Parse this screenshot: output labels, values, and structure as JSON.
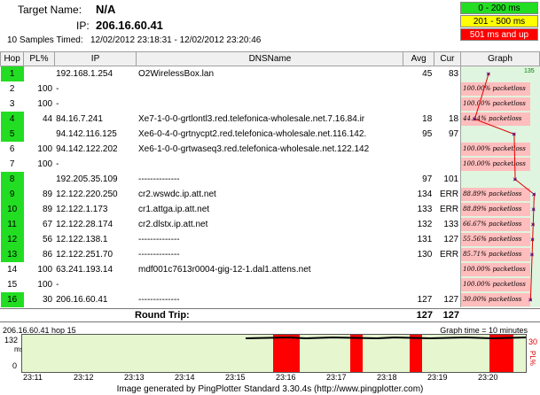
{
  "header": {
    "target_label": "Target Name:",
    "target_value": "N/A",
    "ip_label": "IP:",
    "ip_value": "206.16.60.41",
    "samples": "10 Samples Timed:",
    "range": "12/02/2012 23:18:31 - 12/02/2012 23:20:46",
    "legend": [
      {
        "label": "0 - 200 ms",
        "color": "#22dd22"
      },
      {
        "label": "201 - 500 ms",
        "color": "#ffff00"
      },
      {
        "label": "501 ms and up",
        "color": "#ff0000"
      }
    ]
  },
  "columns": [
    "Hop",
    "PL%",
    "IP",
    "DNSName",
    "Avg",
    "Cur",
    "Graph"
  ],
  "rows": [
    {
      "hop": "1",
      "pl": "",
      "ip": "192.168.1.254",
      "dns": "O2WirelessBox.lan",
      "avg": "45",
      "cur": "83",
      "green": true,
      "plbar": ""
    },
    {
      "hop": "2",
      "pl": "100",
      "ip": "-",
      "dns": "",
      "avg": "",
      "cur": "",
      "green": false,
      "plbar": "100.00% packetloss"
    },
    {
      "hop": "3",
      "pl": "100",
      "ip": "-",
      "dns": "",
      "avg": "",
      "cur": "",
      "green": false,
      "plbar": "100.00% packetloss"
    },
    {
      "hop": "4",
      "pl": "44",
      "ip": "84.16.7.241",
      "dns": "Xe7-1-0-0-grtlontl3.red.telefonica-wholesale.net.7.16.84.ir",
      "avg": "18",
      "cur": "18",
      "green": true,
      "plbar": "44.44% packetloss"
    },
    {
      "hop": "5",
      "pl": "",
      "ip": "94.142.116.125",
      "dns": "Xe6-0-4-0-grtnycpt2.red.telefonica-wholesale.net.116.142.",
      "avg": "95",
      "cur": "97",
      "green": true,
      "plbar": ""
    },
    {
      "hop": "6",
      "pl": "100",
      "ip": "94.142.122.202",
      "dns": "Xe6-1-0-0-grtwaseq3.red.telefonica-wholesale.net.122.142",
      "avg": "",
      "cur": "",
      "green": false,
      "plbar": "100.00% packetloss"
    },
    {
      "hop": "7",
      "pl": "100",
      "ip": "-",
      "dns": "",
      "avg": "",
      "cur": "",
      "green": false,
      "plbar": "100.00% packetloss"
    },
    {
      "hop": "8",
      "pl": "",
      "ip": "192.205.35.109",
      "dns": "--------------",
      "avg": "97",
      "cur": "101",
      "green": true,
      "plbar": ""
    },
    {
      "hop": "9",
      "pl": "89",
      "ip": "12.122.220.250",
      "dns": "cr2.wswdc.ip.att.net",
      "avg": "134",
      "cur": "ERR",
      "green": true,
      "plbar": "88.89% packetloss"
    },
    {
      "hop": "10",
      "pl": "89",
      "ip": "12.122.1.173",
      "dns": "cr1.attga.ip.att.net",
      "avg": "133",
      "cur": "ERR",
      "green": true,
      "plbar": "88.89% packetloss"
    },
    {
      "hop": "11",
      "pl": "67",
      "ip": "12.122.28.174",
      "dns": "cr2.dlstx.ip.att.net",
      "avg": "132",
      "cur": "133",
      "green": true,
      "plbar": "66.67% packetloss"
    },
    {
      "hop": "12",
      "pl": "56",
      "ip": "12.122.138.1",
      "dns": "--------------",
      "avg": "131",
      "cur": "127",
      "green": true,
      "plbar": "55.56% packetloss"
    },
    {
      "hop": "13",
      "pl": "86",
      "ip": "12.122.251.70",
      "dns": "--------------",
      "avg": "130",
      "cur": "ERR",
      "green": true,
      "plbar": "85.71% packetloss"
    },
    {
      "hop": "14",
      "pl": "100",
      "ip": "63.241.193.14",
      "dns": "mdf001c7613r0004-gig-12-1.dal1.attens.net",
      "avg": "",
      "cur": "",
      "green": false,
      "plbar": "100.00% packetloss"
    },
    {
      "hop": "15",
      "pl": "100",
      "ip": "-",
      "dns": "",
      "avg": "",
      "cur": "",
      "green": false,
      "plbar": "100.00% packetloss"
    },
    {
      "hop": "16",
      "pl": "30",
      "ip": "206.16.60.41",
      "dns": "--------------",
      "avg": "127",
      "cur": "127",
      "green": true,
      "plbar": "30.00% packetloss"
    }
  ],
  "graph_extra": {
    "hop1_max": "135"
  },
  "roundtrip": {
    "label": "Round Trip:",
    "avg": "127",
    "cur": "127"
  },
  "bottom": {
    "title": "206.16.60.41 hop 15",
    "graph_time": "Graph time = 10 minutes",
    "y_ticks": [
      "132",
      "0"
    ],
    "y_label": "ms",
    "right_tick": "30",
    "right_label": "PL%",
    "x_labels": [
      "23:11",
      "23:12",
      "23:13",
      "23:14",
      "23:15",
      "23:16",
      "23:17",
      "23:18",
      "23:19",
      "23:20"
    ]
  },
  "footer": "Image generated by PingPlotter Standard 3.30.4s (http://www.pingplotter.com)"
}
